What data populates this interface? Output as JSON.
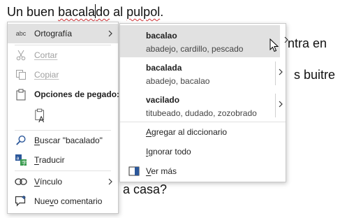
{
  "document": {
    "line1_a": "Un buen ",
    "line1_word_left": "bacala",
    "line1_word_right": "do",
    "line1_b": " al ",
    "line1_c": "pulpol",
    "line1_d": ".",
    "line2_tail": "ntra en",
    "line3_tail": "s buitre",
    "line4_tail": "a casa?"
  },
  "context_menu": {
    "spelling": "Ortografía",
    "spelling_icon_text": "abc",
    "cut": "Cortar",
    "copy": "Copiar",
    "paste_options": "Opciones de pegado:",
    "search_pre": "B",
    "search_rest": "uscar \"bacalado\"",
    "translate_pre": "T",
    "translate_rest": "raducir",
    "link_pre": "V",
    "link_rest": "ínculo",
    "comment_pre": "Nue",
    "comment_u": "v",
    "comment_rest": "o comentario"
  },
  "submenu": {
    "suggestions": [
      {
        "word": "bacalao",
        "synonyms": "abadejo, cardillo, pescado"
      },
      {
        "word": "bacalada",
        "synonyms": "abadejo, bacalao"
      },
      {
        "word": "vacilado",
        "synonyms": "titubeado, dudado, zozobrado"
      }
    ],
    "add_pre": "A",
    "add_rest": "gregar al diccionario",
    "ignore_pre": "I",
    "ignore_rest": "gnorar todo",
    "more_pre": "V",
    "more_rest": "er más"
  },
  "colors": {
    "accent_blue": "#2b579a",
    "squiggle_red": "#d13438",
    "hover": "#e1e1e1"
  }
}
